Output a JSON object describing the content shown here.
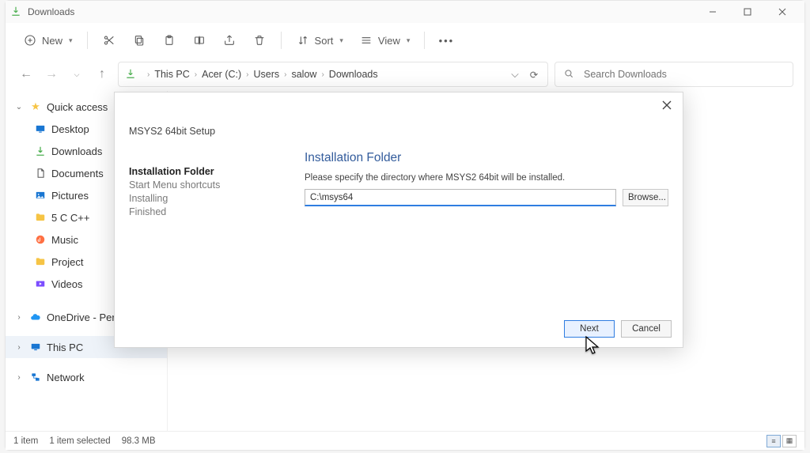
{
  "window": {
    "title": "Downloads"
  },
  "toolbar": {
    "new_label": "New",
    "sort_label": "Sort",
    "view_label": "View"
  },
  "breadcrumb": [
    "This PC",
    "Acer (C:)",
    "Users",
    "salow",
    "Downloads"
  ],
  "search": {
    "placeholder": "Search Downloads"
  },
  "sidebar": {
    "quick_access": "Quick access",
    "items": [
      {
        "label": "Desktop",
        "icon": "desktop",
        "pinned": true
      },
      {
        "label": "Downloads",
        "icon": "download",
        "pinned": true
      },
      {
        "label": "Documents",
        "icon": "document",
        "pinned": true
      },
      {
        "label": "Pictures",
        "icon": "picture",
        "pinned": true
      },
      {
        "label": "5 C C++",
        "icon": "folder"
      },
      {
        "label": "Music",
        "icon": "music"
      },
      {
        "label": "Project",
        "icon": "folder"
      },
      {
        "label": "Videos",
        "icon": "video"
      }
    ],
    "onedrive": "OneDrive - Persona",
    "thispc": "This PC",
    "network": "Network"
  },
  "status": {
    "count": "1 item",
    "selected": "1 item selected",
    "size": "98.3 MB"
  },
  "dialog": {
    "title": "MSYS2 64bit Setup",
    "steps": [
      "Installation Folder",
      "Start Menu shortcuts",
      "Installing",
      "Finished"
    ],
    "heading": "Installation Folder",
    "subtitle": "Please specify the directory where MSYS2 64bit will be installed.",
    "path": "C:\\msys64",
    "browse": "Browse...",
    "next": "Next",
    "cancel": "Cancel"
  }
}
